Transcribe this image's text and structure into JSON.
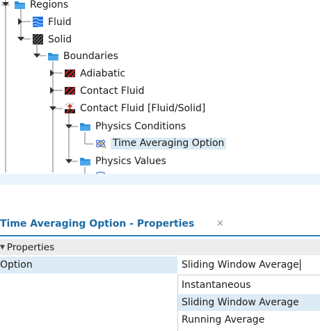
{
  "tree": {
    "regions_label": "Regions",
    "fluid_label": "Fluid",
    "solid_label": "Solid",
    "boundaries_label": "Boundaries",
    "adiabatic_label": "Adiabatic",
    "contact_fluid_label": "Contact Fluid",
    "contact_fluid_solid_label": "Contact Fluid [Fluid/Solid]",
    "physics_conditions_label": "Physics Conditions",
    "time_averaging_label": "Time Averaging Option",
    "physics_values_label": "Physics Values"
  },
  "properties_panel": {
    "title": "Time Averaging Option - Properties",
    "close_glyph": "×",
    "section_label": "Properties",
    "option_name": "Option",
    "option_value": "Sliding Window Average",
    "dropdown_options": [
      "Instantaneous",
      "Sliding Window Average",
      "Running Average"
    ],
    "selected_index": 1
  },
  "colors": {
    "folder": "#2b8fd6",
    "selection": "#dcebf5",
    "title_text": "#1c6aa3",
    "title_underline": "#2a7fb8",
    "status_strip": "#eaf6fc",
    "fluid_icon": "#1f6fe0",
    "solid_icon": "#1e1e1e",
    "boundary_icon_red": "#d32020"
  },
  "icons": {
    "folder": "folder-icon",
    "fluid_region": "fluid-region-icon",
    "solid_region": "solid-region-icon",
    "wall_boundary": "wall-boundary-icon",
    "interface_boundary": "interface-boundary-icon",
    "condition": "physics-condition-icon"
  }
}
